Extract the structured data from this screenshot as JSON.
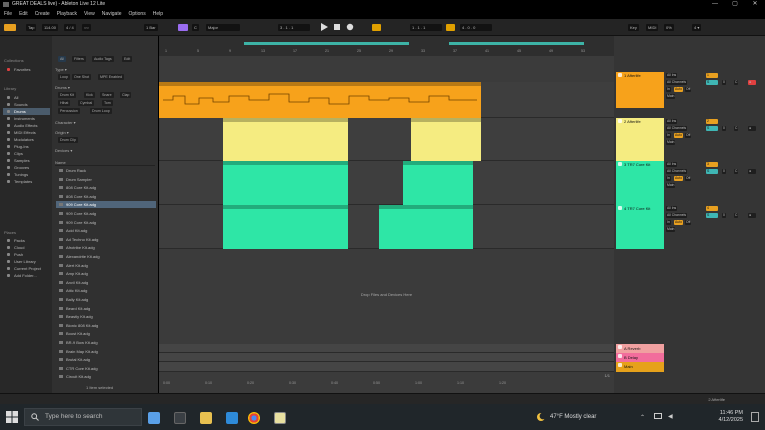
{
  "window": {
    "title": "GREAT DEALS live) - Ableton Live 12 Lite",
    "controls": [
      "—",
      "▢",
      "✕"
    ]
  },
  "menu": [
    "File",
    "Edit",
    "Create",
    "Playback",
    "View",
    "Navigate",
    "Options",
    "Help"
  ],
  "transport": {
    "tap": "Tap",
    "tempo": "114.00",
    "time_sig": "4 / 4",
    "metronome": "○○",
    "quantize": "1 Bar",
    "key": "C",
    "scale": "Major",
    "position": "3 . 1 . 1",
    "loop_start": "1 . 1 . 1",
    "loop_length": "4 . 0 . 0",
    "key_label": "Key",
    "midi_label": "MIDI",
    "cpu": "0%",
    "zoom": "4 ▾"
  },
  "browser": {
    "search_placeholder": "Search (Ctrl + F)",
    "tabs": [
      "All",
      "Filters",
      "Audio Tags",
      "Edit"
    ],
    "sections": {
      "collections": "Collections",
      "library": "Library",
      "places": "Places"
    },
    "collections": [
      "Favorites"
    ],
    "library_items": [
      "All",
      "Sounds",
      "Drums",
      "Instruments",
      "Audio Effects",
      "MIDI Effects",
      "Modulators",
      "Plug-Ins",
      "Clips",
      "Samples",
      "Grooves",
      "Tunings",
      "Templates"
    ],
    "places_items": [
      "Packs",
      "Cloud",
      "Push",
      "User Library",
      "Current Project",
      "Add Folder..."
    ],
    "selected_library": "Drums",
    "filters": {
      "type_label": "Type ▾",
      "type_chips": [
        "Loop",
        "One Shot",
        "MPE Enabled"
      ],
      "drums_label": "Drums ▾",
      "drum_chips": [
        "Drum Kit",
        "Kick",
        "Snare",
        "Clap",
        "Hihat",
        "Cymbal",
        "Tom",
        "Percussion",
        "Drum Loop"
      ],
      "character_label": "Character ▾",
      "origin_label": "Origin ▾",
      "origin_chips": [
        "Drum Clip"
      ],
      "devices_label": "Devices ▾"
    },
    "list_header": "Name",
    "files": [
      "Drum Rack",
      "Drum Sampler",
      "808 Core Kit.adg",
      "808 Core Kit.adg",
      "909 Core Kit.adg",
      "909 Core Kit.adg",
      "909 Core Kit.adg",
      "Acid Kit.adg",
      "Ad Techno Kit.adg",
      "Afrotribe Kit.adg",
      "Alexandrite Kit.adg",
      "Alert Kit.adg",
      "Amp Kit.adg",
      "Anvil Kit.adg",
      "Attic Kit.adg",
      "Bally Kit.adg",
      "Beard Kit.adg",
      "Beastly Kit.adg",
      "Bionic 808 Kit.adg",
      "Boost Kit.adg",
      "BR-9 Bow Kit.adg",
      "Brain Map Kit.adg",
      "Brutal Kit.adg",
      "CTR Core Kit.adg",
      "Circuit Kit.adg"
    ],
    "selected_file_index": 4,
    "footer": "1 Item selected"
  },
  "arrangement": {
    "bar_numbers": [
      "1",
      "5",
      "9",
      "13",
      "17",
      "21",
      "25",
      "29",
      "33",
      "37",
      "41",
      "45",
      "49",
      "53"
    ],
    "drop_hint": "Drop Files and Devices Here",
    "time_labels": [
      "0:00",
      "0:10",
      "0:20",
      "0:30",
      "0:40",
      "0:50",
      "1:00",
      "1:10",
      "1:20"
    ],
    "page_indicator": "1/1"
  },
  "tracks": [
    {
      "name": "1 Afterlife",
      "color": "#f7a21b",
      "input": "All Ins",
      "channel": "All Channels",
      "monitor": [
        "In",
        "Auto",
        "Off"
      ],
      "out": "Main",
      "volume": "0",
      "pan": "C",
      "number": "1"
    },
    {
      "name": "2 Afterlife",
      "color": "#f5ec81",
      "input": "All Ins",
      "channel": "All Channels",
      "monitor": [
        "In",
        "Auto",
        "Off"
      ],
      "out": "Main",
      "volume": "0",
      "pan": "C",
      "number": "2"
    },
    {
      "name": "3 TR7 Core Kit",
      "color": "#2ee6a6",
      "input": "All Ins",
      "channel": "All Channels",
      "monitor": [
        "In",
        "Auto",
        "Off"
      ],
      "out": "Main",
      "volume": "0",
      "pan": "C",
      "number": "3"
    },
    {
      "name": "4 TR7 Core Kit",
      "color": "#2ee6a6",
      "input": "All Ins",
      "channel": "All Channels",
      "monitor": [
        "In",
        "Auto",
        "Off"
      ],
      "out": "Main",
      "volume": "0",
      "pan": "C",
      "number": "4"
    }
  ],
  "returns": [
    {
      "name": "A Reverb",
      "color": "#f0a0a0"
    },
    {
      "name": "B Delay",
      "color": "#f26d9c"
    },
    {
      "name": "Main",
      "color": "#e6a11b",
      "tempo_val": "1/2",
      "vol": "0"
    }
  ],
  "status": {
    "left": "",
    "right": "2 Afterlife"
  },
  "taskbar": {
    "search_placeholder": "Type here to search",
    "weather": "47°F  Mostly clear",
    "time": "11:46 PM",
    "date": "4/12/2025"
  },
  "colors": {
    "orange": "#f7a21b",
    "yellow": "#f5ec81",
    "green": "#2ee6a6",
    "teal": "#3db3a6"
  }
}
